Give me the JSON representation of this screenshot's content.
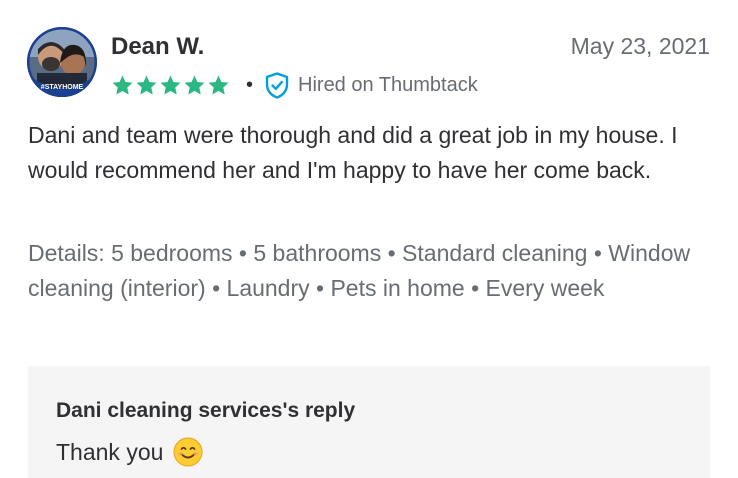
{
  "review": {
    "reviewer_name": "Dean W.",
    "avatar_badge": "#STAYHOME",
    "date": "May 23, 2021",
    "rating": 5,
    "rating_max": 5,
    "separator": "•",
    "hired_label": "Hired on Thumbtack",
    "body": "Dani and team were thorough and did a great job in my house. I would recommend her and I'm happy to have her come back.",
    "details": "Details: 5 bedrooms • 5 bathrooms • Standard cleaning • Window cleaning (interior) • Laundry • Pets in home • Every week"
  },
  "reply": {
    "title": "Dani cleaning services's reply",
    "text": "Thank you",
    "emoji": "smiling-face-emoji"
  },
  "colors": {
    "star": "#2db783",
    "hired_icon": "#009fd9",
    "muted_text": "#676d73",
    "body_text": "#2f3033",
    "reply_bg": "#f5f5f6"
  }
}
